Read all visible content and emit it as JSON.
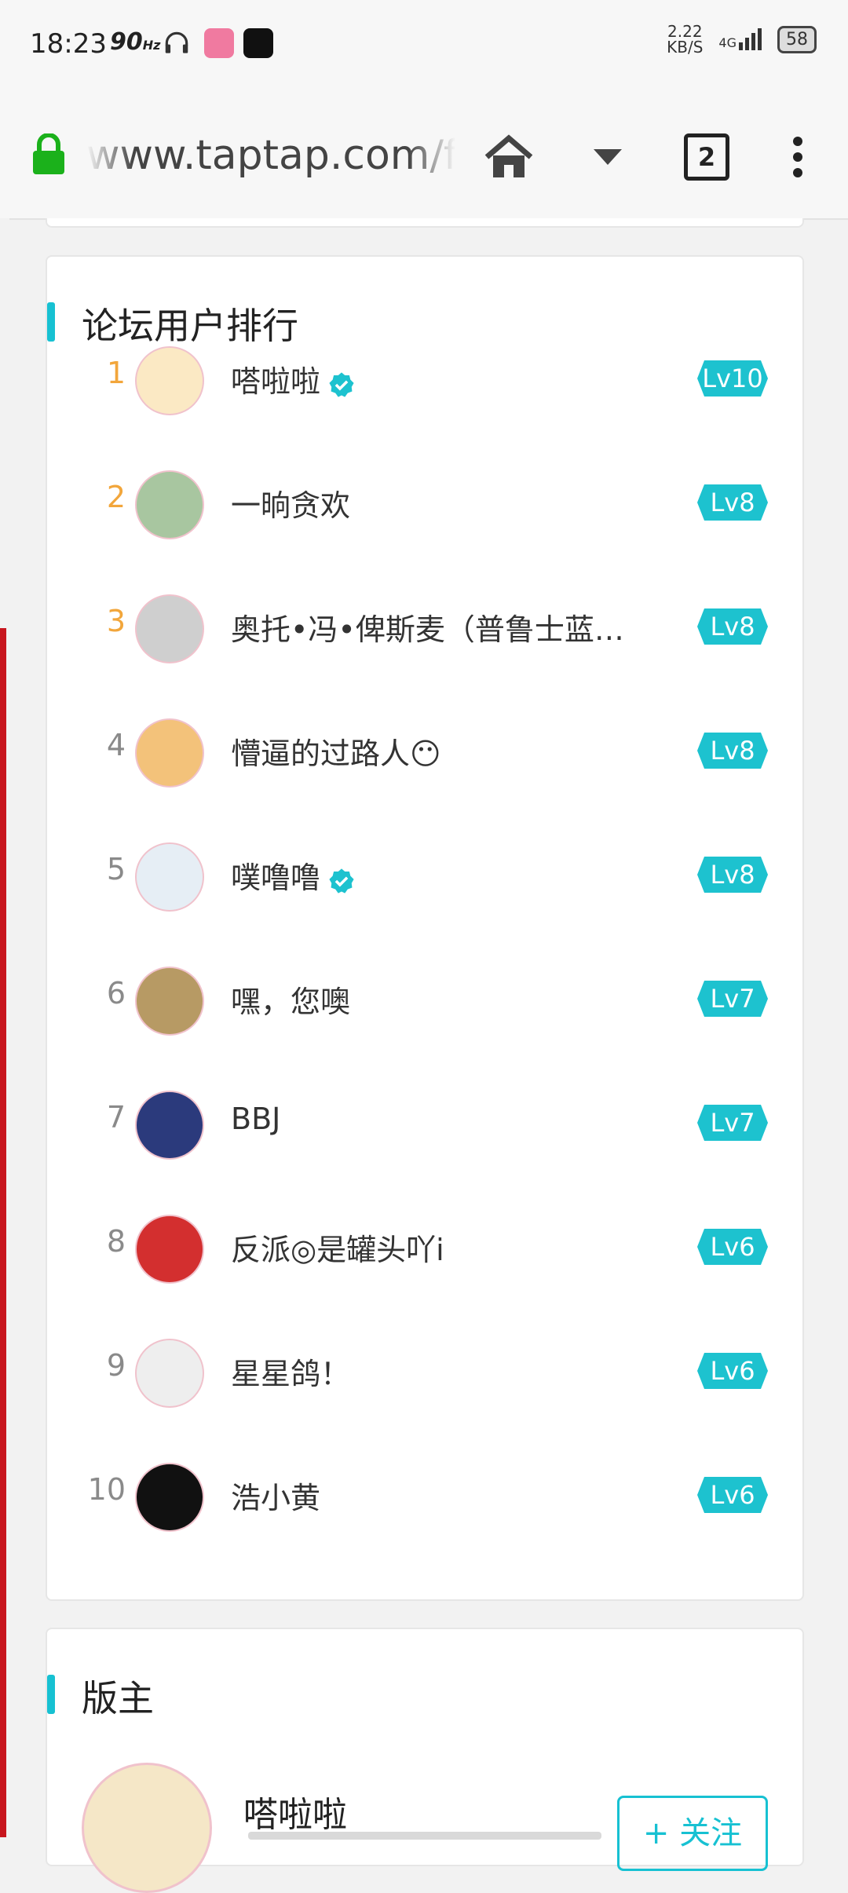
{
  "status_bar": {
    "time": "18:23",
    "refresh_rate": "90",
    "refresh_unit": "Hz",
    "speed_value": "2.22",
    "speed_unit": "KB/S",
    "network": "4G",
    "battery": "58"
  },
  "browser": {
    "url": "www.taptap.com/fc",
    "tab_count": "2"
  },
  "ranking": {
    "title": "论坛用户排行",
    "users": [
      {
        "rank": "1",
        "name": "嗒啦啦",
        "verified": true,
        "level": "Lv10"
      },
      {
        "rank": "2",
        "name": "一晌贪欢",
        "verified": false,
        "level": "Lv8"
      },
      {
        "rank": "3",
        "name": "奥托•冯•俾斯麦（普鲁士蓝…",
        "verified": false,
        "level": "Lv8"
      },
      {
        "rank": "4",
        "name": "懵逼的过路人😶",
        "verified": false,
        "level": "Lv8"
      },
      {
        "rank": "5",
        "name": "噗噜噜",
        "verified": true,
        "level": "Lv8"
      },
      {
        "rank": "6",
        "name": "嘿，您噢",
        "verified": false,
        "level": "Lv7"
      },
      {
        "rank": "7",
        "name": "BBJ",
        "verified": false,
        "level": "Lv7"
      },
      {
        "rank": "8",
        "name": "反派◎是罐头吖i",
        "verified": false,
        "level": "Lv6"
      },
      {
        "rank": "9",
        "name": "星星鸽！",
        "verified": false,
        "level": "Lv6"
      },
      {
        "rank": "10",
        "name": "浩小黄",
        "verified": false,
        "level": "Lv6"
      }
    ]
  },
  "moderators": {
    "title": "版主",
    "name": "嗒啦啦",
    "follow_label": "+ 关注"
  },
  "colors": {
    "accent": "#17c1d2",
    "level_badge": "#1dc2cf",
    "top_rank": "#f2a63b",
    "side_red": "#c8161e"
  }
}
